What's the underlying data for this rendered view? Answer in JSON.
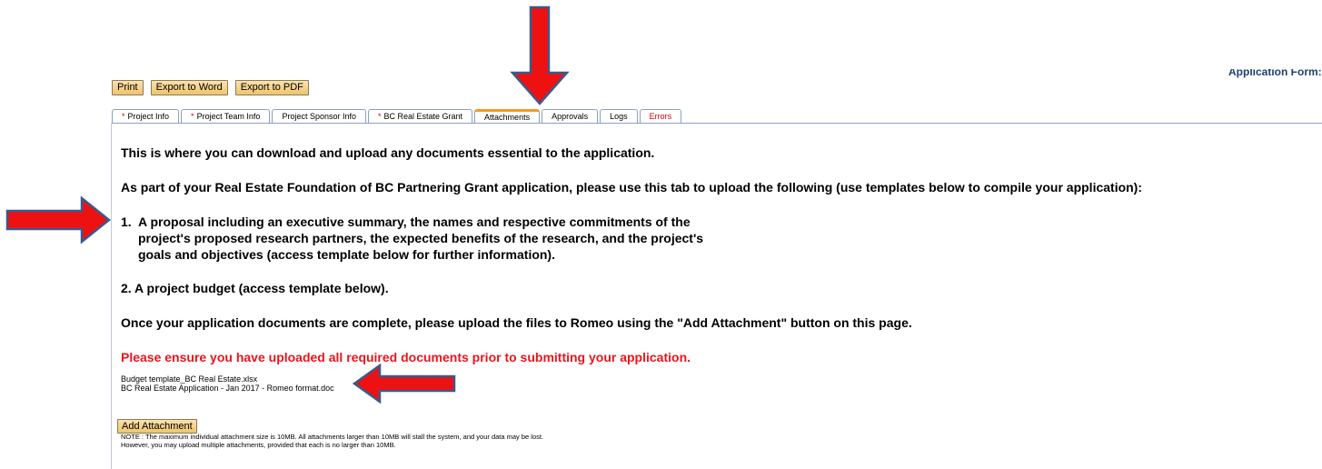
{
  "header": {
    "application_form_label": "Application Form: BC"
  },
  "toolbar": {
    "print_label": "Print",
    "export_word_label": "Export to Word",
    "export_pdf_label": "Export to PDF"
  },
  "tabs": [
    {
      "label": "Project Info",
      "required": "*"
    },
    {
      "label": "Project Team Info",
      "required": "*"
    },
    {
      "label": "Project Sponsor Info",
      "required": ""
    },
    {
      "label": "BC Real Estate Grant",
      "required": "*"
    },
    {
      "label": "Attachments",
      "required": ""
    },
    {
      "label": "Approvals",
      "required": ""
    },
    {
      "label": "Logs",
      "required": ""
    },
    {
      "label": "Errors",
      "required": ""
    }
  ],
  "content": {
    "intro": "This is where you can download and upload any documents essential to the application.",
    "instructions": "As part of your Real Estate Foundation of BC Partnering Grant application, please use this tab to upload the following (use templates below to compile your application):",
    "item1_num": "1.",
    "item1_line1": "A proposal including an executive summary, the names and respective commitments of the",
    "item1_line2": "project's proposed research partners, the expected benefits of the research, and the project's",
    "item1_line3": "goals and objectives (access template below for further information).",
    "item2": "2.  A project budget (access template below).",
    "upload_instruction": "Once your application documents are complete, please upload the files to Romeo using the \"Add Attachment\" button on this page.",
    "warning": "Please ensure you have uploaded all required documents prior to submitting your application."
  },
  "files": [
    "Budget template_BC Real Estate.xlsx",
    "BC Real Estate Application - Jan 2017 - Romeo format.doc"
  ],
  "attachment": {
    "add_label": "Add Attachment",
    "note_line1": "NOTE : The maximum individual attachment size is 10MB. All attachments larger than 10MB will stall the system, and your data may be lost.",
    "note_line2": "However, you may upload multiple attachments, provided that each is no larger than 10MB."
  },
  "colors": {
    "arrow_fill": "#ee1111",
    "arrow_outline": "#3a5a8c",
    "active_tab_accent": "#f39a1f",
    "warning_text": "#e8151b"
  }
}
